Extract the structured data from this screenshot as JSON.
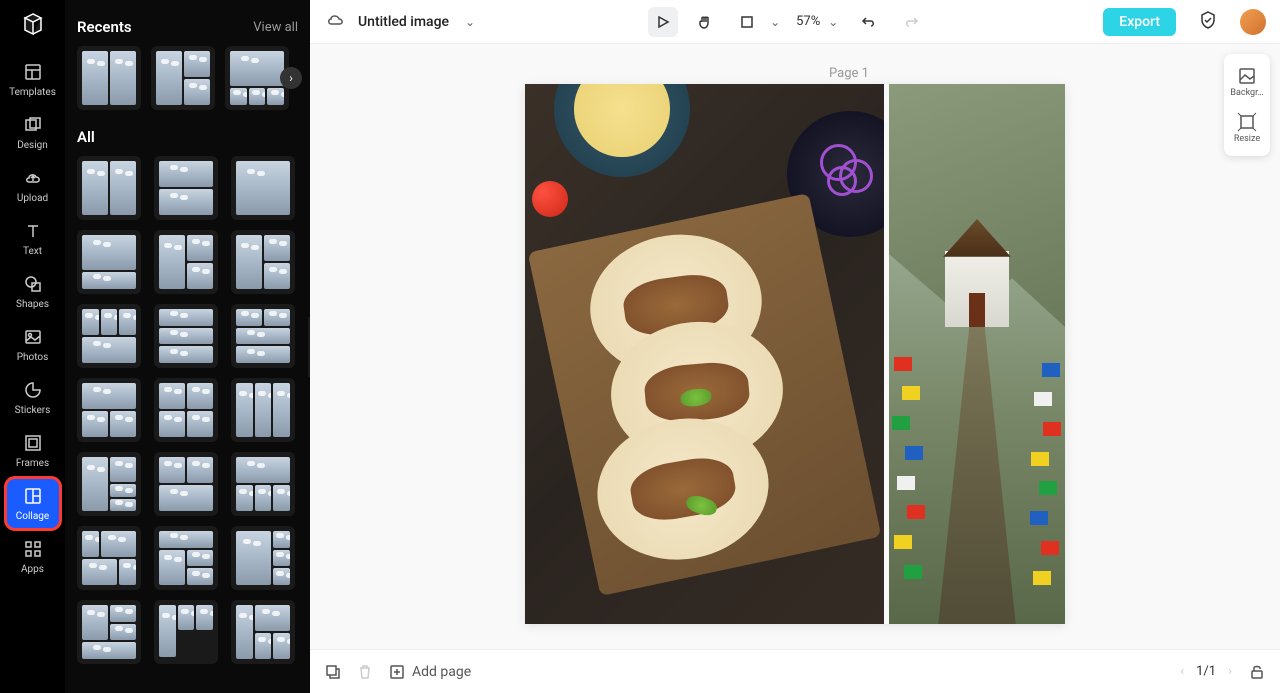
{
  "nav": {
    "items": [
      {
        "id": "templates",
        "label": "Templates"
      },
      {
        "id": "design",
        "label": "Design"
      },
      {
        "id": "upload",
        "label": "Upload"
      },
      {
        "id": "text",
        "label": "Text"
      },
      {
        "id": "shapes",
        "label": "Shapes"
      },
      {
        "id": "photos",
        "label": "Photos"
      },
      {
        "id": "stickers",
        "label": "Stickers"
      },
      {
        "id": "frames",
        "label": "Frames"
      },
      {
        "id": "collage",
        "label": "Collage"
      },
      {
        "id": "apps",
        "label": "Apps"
      }
    ]
  },
  "panel": {
    "recents_title": "Recents",
    "view_all": "View all",
    "all_title": "All"
  },
  "topbar": {
    "doc_title": "Untitled image",
    "zoom": "57%",
    "export": "Export"
  },
  "canvas": {
    "page_label": "Page 1"
  },
  "right_tools": {
    "background": "Backgr…",
    "resize": "Resize"
  },
  "bottombar": {
    "add_page": "Add page",
    "page_indicator": "1/1"
  }
}
